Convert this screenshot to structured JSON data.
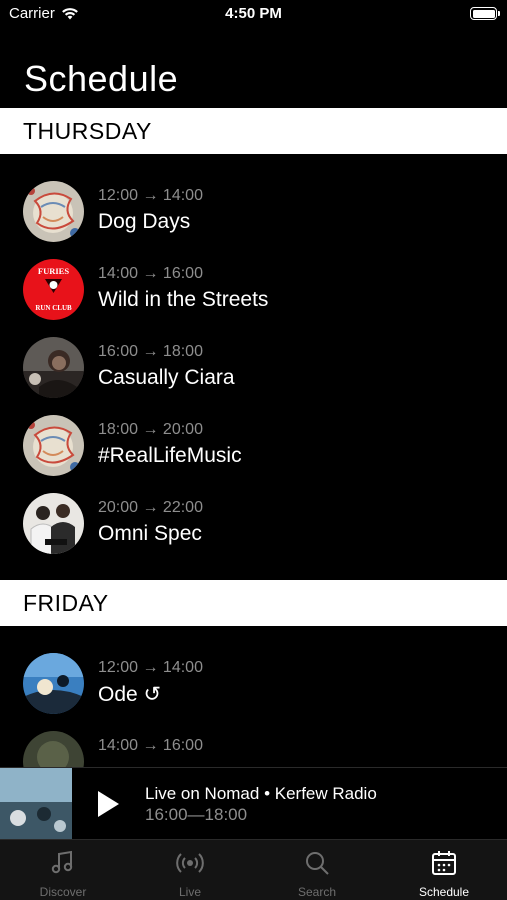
{
  "status_bar": {
    "carrier": "Carrier",
    "time": "4:50 PM"
  },
  "page_title": "Schedule",
  "days": [
    {
      "label": "THURSDAY",
      "shows": [
        {
          "time": "12:00 → 14:00",
          "title": "Dog Days"
        },
        {
          "time": "14:00 → 16:00",
          "title": "Wild in the Streets",
          "avatar_text_top": "FURIES",
          "avatar_text_bottom": "RUN CLUB"
        },
        {
          "time": "16:00 → 18:00",
          "title": "Casually Ciara"
        },
        {
          "time": "18:00 → 20:00",
          "title": "#RealLifeMusic"
        },
        {
          "time": "20:00 → 22:00",
          "title": "Omni Spec"
        }
      ]
    },
    {
      "label": "FRIDAY",
      "shows": [
        {
          "time": "12:00 → 14:00",
          "title": "Ode ↺"
        },
        {
          "time": "14:00 → 16:00",
          "title": ""
        }
      ]
    }
  ],
  "mini_player": {
    "title": "Live on Nomad • Kerfew Radio",
    "time": "16:00—18:00",
    "play_icon": "play-icon"
  },
  "tab_bar": {
    "tabs": [
      {
        "label": "Discover",
        "icon": "music-note-icon"
      },
      {
        "label": "Live",
        "icon": "broadcast-icon"
      },
      {
        "label": "Search",
        "icon": "search-icon"
      },
      {
        "label": "Schedule",
        "icon": "calendar-icon"
      }
    ],
    "active": "Schedule"
  },
  "colors": {
    "background": "#000000",
    "header_bg": "#ffffff",
    "muted_text": "#8e8e8e",
    "furies_red": "#e8121a"
  }
}
